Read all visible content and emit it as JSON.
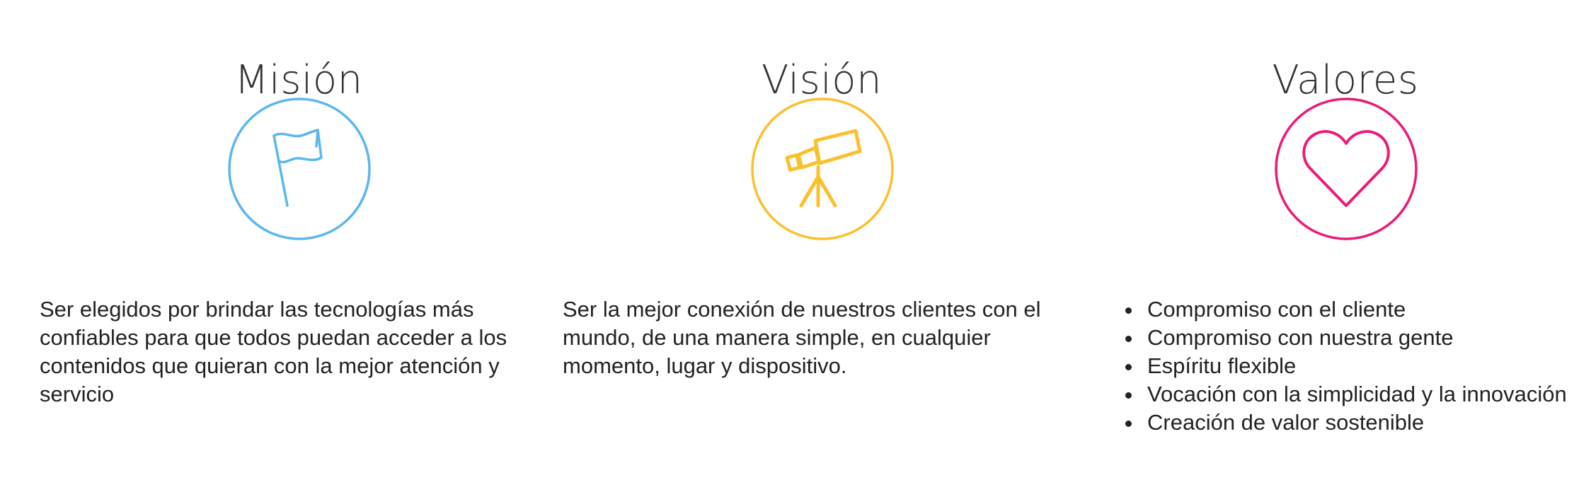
{
  "mision": {
    "title": "Misión",
    "icon": "flag-icon",
    "color": "#5BB7EE",
    "text": "Ser elegidos por brindar las tecnologías más confiables para que todos puedan acceder a los contenidos que quieran con la mejor atención y servicio"
  },
  "vision": {
    "title": "Visión",
    "icon": "telescope-icon",
    "color": "#FBC02D",
    "text": "Ser la mejor conexión de nuestros clientes con el mundo, de una manera simple, en cualquier momento, lugar y dispositivo."
  },
  "valores": {
    "title": "Valores",
    "icon": "heart-icon",
    "color": "#EC1A78",
    "items": [
      "Compromiso con el cliente",
      "Compromiso con nuestra gente",
      "Espíritu flexible",
      "Vocación con la simplicidad y la innovación",
      "Creación de valor sostenible"
    ]
  }
}
